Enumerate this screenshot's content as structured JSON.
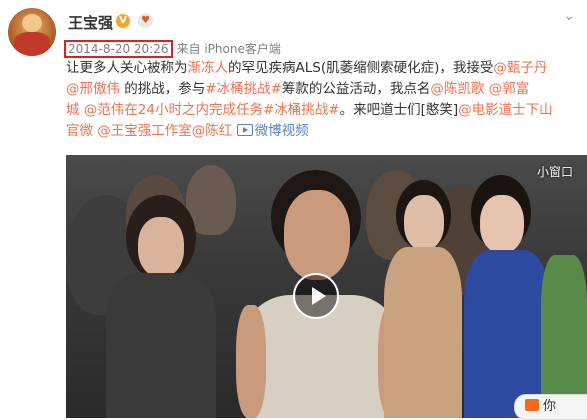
{
  "header": {
    "name": "王宝强",
    "verified_badge": "V",
    "heart_icon": "heart-icon",
    "menu_icon": "chevron-down-icon",
    "timestamp": "2014-8-20 20:26",
    "source": "来自 iPhone客户端"
  },
  "post": {
    "lines": [
      [
        {
          "t": "让更多人关心被称为",
          "c": "plain"
        },
        {
          "t": "渐冻人",
          "c": "link"
        },
        {
          "t": "的罕见疾病ALS(肌萎缩侧索硬化症)，我接受",
          "c": "plain"
        },
        {
          "t": "@甄子丹",
          "c": "link"
        }
      ],
      [
        {
          "t": "@邢傲伟",
          "c": "link"
        },
        {
          "t": " 的挑战，参与",
          "c": "plain"
        },
        {
          "t": "#冰桶挑战#",
          "c": "link"
        },
        {
          "t": "筹款的公益活动，我点名",
          "c": "plain"
        },
        {
          "t": "@陈凯歌",
          "c": "link"
        },
        {
          "t": " ",
          "c": "plain"
        },
        {
          "t": "@郭富",
          "c": "link"
        }
      ],
      [
        {
          "t": "城",
          "c": "link"
        },
        {
          "t": " ",
          "c": "plain"
        },
        {
          "t": "@范伟",
          "c": "link"
        },
        {
          "t": "在24小时之内完成任务",
          "c": "link"
        },
        {
          "t": "#冰桶挑战#",
          "c": "link"
        },
        {
          "t": "。来吧道士们[憨笑]",
          "c": "plain"
        },
        {
          "t": "@电影道士下山",
          "c": "link"
        }
      ],
      [
        {
          "t": "官微",
          "c": "link"
        },
        {
          "t": " ",
          "c": "plain"
        },
        {
          "t": "@王宝强工作室",
          "c": "link"
        },
        {
          "t": "@陈红",
          "c": "link"
        },
        {
          "t": " ",
          "c": "plain"
        },
        {
          "t": "微博视频",
          "c": "blue"
        }
      ]
    ]
  },
  "video": {
    "mini_window_label": "小窗口",
    "play_icon": "play-icon"
  },
  "floating": {
    "label": "你"
  },
  "colors": {
    "link": "#eb7350",
    "highlight_box": "#e02020",
    "video_link": "#5783c3"
  }
}
